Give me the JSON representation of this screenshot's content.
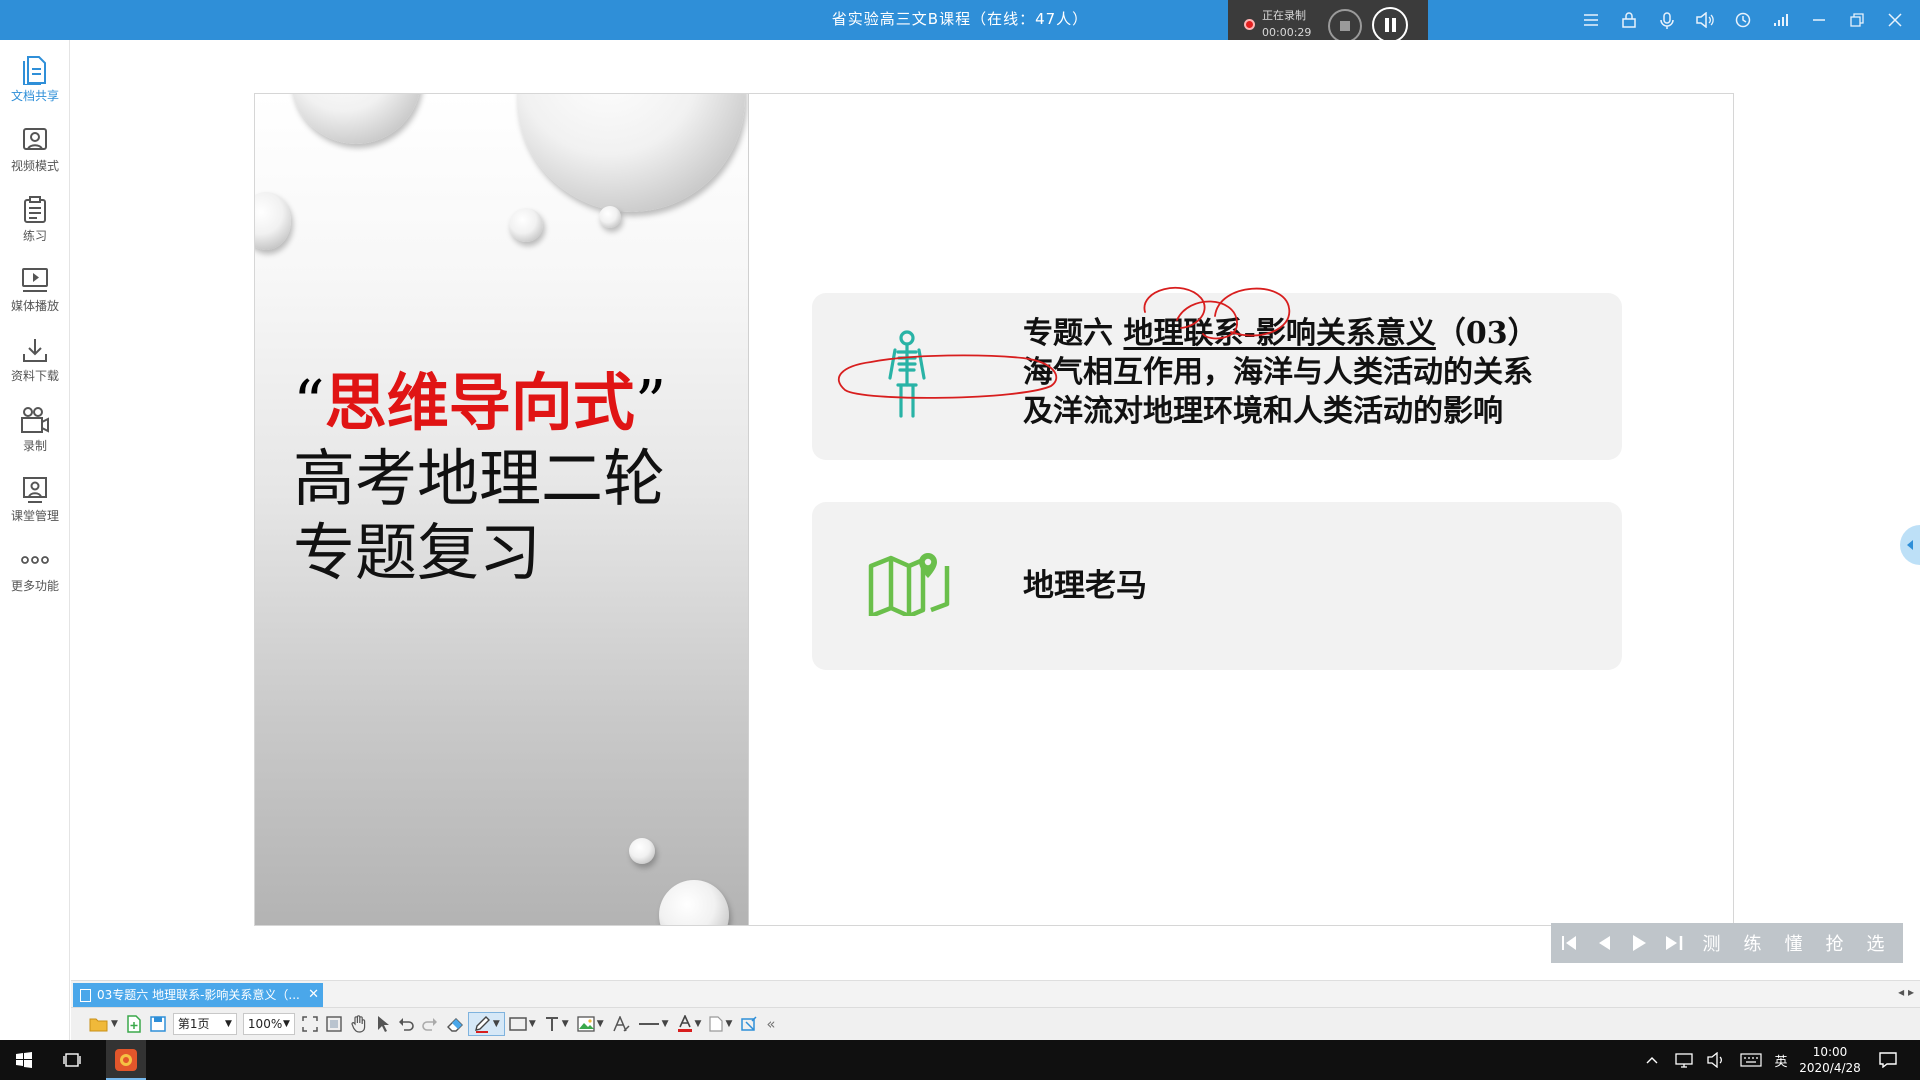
{
  "window": {
    "title": "省实验高三文B课程（在线：47人）",
    "recording_status": "正在录制",
    "recording_time": "00:00:29",
    "title_icons": [
      "menu-icon",
      "lock-icon",
      "mic-icon",
      "speaker-icon",
      "clock-icon",
      "signal-icon",
      "minimize-icon",
      "restore-icon",
      "close-icon"
    ]
  },
  "sidebar": {
    "items": [
      {
        "label": "文档共享",
        "icon": "document-share-icon",
        "active": true
      },
      {
        "label": "视频模式",
        "icon": "video-mode-icon"
      },
      {
        "label": "练习",
        "icon": "exercise-icon"
      },
      {
        "label": "媒体播放",
        "icon": "media-play-icon"
      },
      {
        "label": "资料下载",
        "icon": "download-icon"
      },
      {
        "label": "录制",
        "icon": "record-icon"
      },
      {
        "label": "课堂管理",
        "icon": "class-manage-icon"
      },
      {
        "label": "更多功能",
        "icon": "more-icon"
      }
    ]
  },
  "slide": {
    "quote_open": "“",
    "title_red": "思维导向式",
    "quote_close": "”",
    "subtitle_line1": "高考地理二轮",
    "subtitle_line2": "专题复习",
    "card1": {
      "prefix": "专题六 ",
      "underlined": "地理联系-影响关系意义",
      "suffix": "（03）",
      "line2": "海气相互作用，海洋与人类活动的关系",
      "line3": "及洋流对地理环境和人类活动的影响",
      "icon": "skeleton-icon"
    },
    "card2": {
      "text": "地理老马",
      "icon": "map-pin-icon"
    },
    "ink_color": "#d81e1e",
    "accent_teal": "#29b3a6",
    "accent_green": "#6abf4b"
  },
  "nav_panel": {
    "buttons": [
      "first-page-icon",
      "prev-page-icon",
      "play-icon",
      "last-page-icon"
    ],
    "quick_actions": [
      "测",
      "练",
      "懂",
      "抢",
      "选"
    ]
  },
  "doc_tab": {
    "label": "03专题六 地理联系-影响关系意义（..."
  },
  "toolbar": {
    "page_select": "第1页",
    "zoom_select": "100%"
  },
  "taskbar": {
    "ime": "英",
    "time": "10:00",
    "date": "2020/4/28"
  },
  "colors": {
    "title_bar": "#2f8fd8",
    "sidebar_active": "#2f8fd8",
    "doc_tab": "#4aa7ea"
  }
}
